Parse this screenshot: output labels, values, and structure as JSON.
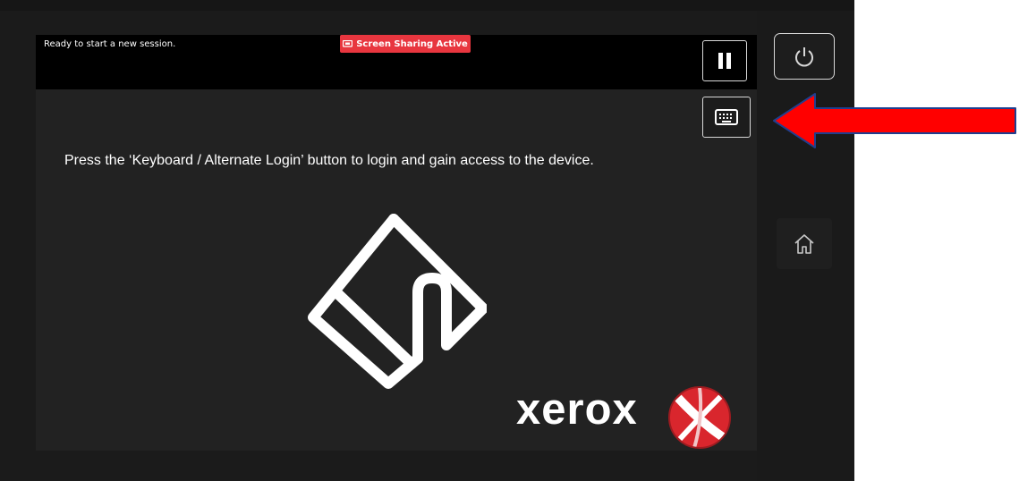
{
  "status_bar": {
    "message": "Ready to start a new session.",
    "sharing_badge": "Screen Sharing Active",
    "sharing_badge_color": "#e8363f"
  },
  "buttons": {
    "pause_icon": "pause-icon",
    "keyboard_icon": "keyboard-icon",
    "power_icon": "power-icon",
    "home_icon": "home-icon"
  },
  "main": {
    "instruction": "Press the ‘Keyboard / Alternate Login’ button to login and gain access to the device.",
    "illustration_icon": "card-reader-icon"
  },
  "branding": {
    "logo_text": "xerox",
    "logo_mark_color": "#d9262d"
  },
  "annotation": {
    "arrow_color": "#ff0000",
    "arrow_outline_color": "#1f3f8f"
  }
}
